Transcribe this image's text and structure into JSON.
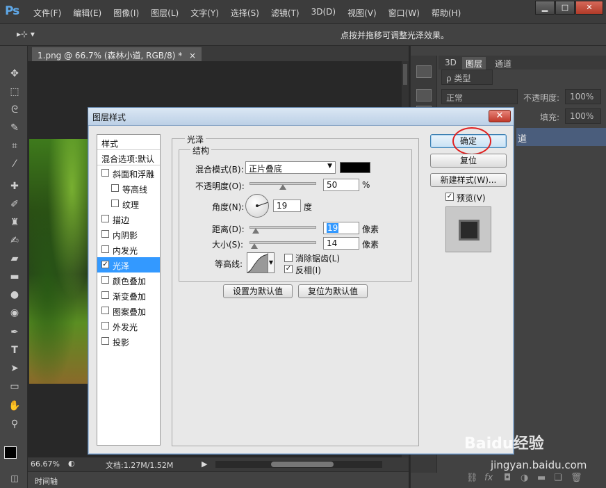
{
  "app": {
    "logo": "Ps"
  },
  "menu": [
    "文件(F)",
    "编辑(E)",
    "图像(I)",
    "图层(L)",
    "文字(Y)",
    "选择(S)",
    "滤镜(T)",
    "3D(D)",
    "视图(V)",
    "窗口(W)",
    "帮助(H)"
  ],
  "window_controls": {
    "minimize": "▁",
    "restore": "□",
    "close": "✕"
  },
  "options_bar": {
    "tool_glyph": "▸⊹ ▾",
    "hint": "点按并拖移可调整光泽效果。"
  },
  "document": {
    "tab_label": "1.png @ 66.7% (森林小道, RGB/8) *",
    "tab_close": "×"
  },
  "status": {
    "zoom": "66.67%",
    "doc": "文档:1.27M/1.52M"
  },
  "timeline": {
    "label": "时间轴"
  },
  "layers_panel": {
    "tabs": [
      "3D",
      "图层",
      "通道"
    ],
    "active_tab": "图层",
    "filter_label": "ρ 类型",
    "blend_mode": "正常",
    "opacity_label": "不透明度:",
    "opacity_value": "100%",
    "fill_label": "填充:",
    "fill_value": "100%",
    "layer_name_visible": "道"
  },
  "dialog": {
    "title": "图层样式",
    "close": "✕",
    "styles_header": "样式",
    "blend_options": "混合选项:默认",
    "style_items": [
      {
        "label": "斜面和浮雕",
        "checked": false,
        "indent": false
      },
      {
        "label": "等高线",
        "checked": false,
        "indent": true
      },
      {
        "label": "纹理",
        "checked": false,
        "indent": true
      },
      {
        "label": "描边",
        "checked": false,
        "indent": false
      },
      {
        "label": "内阴影",
        "checked": false,
        "indent": false
      },
      {
        "label": "内发光",
        "checked": false,
        "indent": false
      },
      {
        "label": "光泽",
        "checked": true,
        "indent": false,
        "selected": true
      },
      {
        "label": "颜色叠加",
        "checked": false,
        "indent": false
      },
      {
        "label": "渐变叠加",
        "checked": false,
        "indent": false
      },
      {
        "label": "图案叠加",
        "checked": false,
        "indent": false
      },
      {
        "label": "外发光",
        "checked": false,
        "indent": false
      },
      {
        "label": "投影",
        "checked": false,
        "indent": false
      }
    ],
    "section_title": "光泽",
    "structure_title": "结构",
    "blend_mode_label": "混合模式(B):",
    "blend_mode_value": "正片叠底",
    "blend_color": "#000000",
    "opacity_label": "不透明度(O):",
    "opacity_value": "50",
    "opacity_unit": "%",
    "angle_label": "角度(N):",
    "angle_value": "19",
    "angle_unit": "度",
    "distance_label": "距离(D):",
    "distance_value": "19",
    "distance_unit": "像素",
    "size_label": "大小(S):",
    "size_value": "14",
    "size_unit": "像素",
    "contour_label": "等高线:",
    "antialias_label": "消除锯齿(L)",
    "antialias_checked": false,
    "invert_label": "反相(I)",
    "invert_checked": true,
    "set_default": "设置为默认值",
    "reset_default": "复位为默认值",
    "ok": "确定",
    "reset": "复位",
    "new_style": "新建样式(W)...",
    "preview_label": "预览(V)",
    "preview_checked": true,
    "slider_levels": {
      "opacity": 0.5,
      "distance": 0.08,
      "size": 0.06
    }
  },
  "watermark": {
    "brand": "Baidu经验",
    "url": "jingyan.baidu.com"
  }
}
